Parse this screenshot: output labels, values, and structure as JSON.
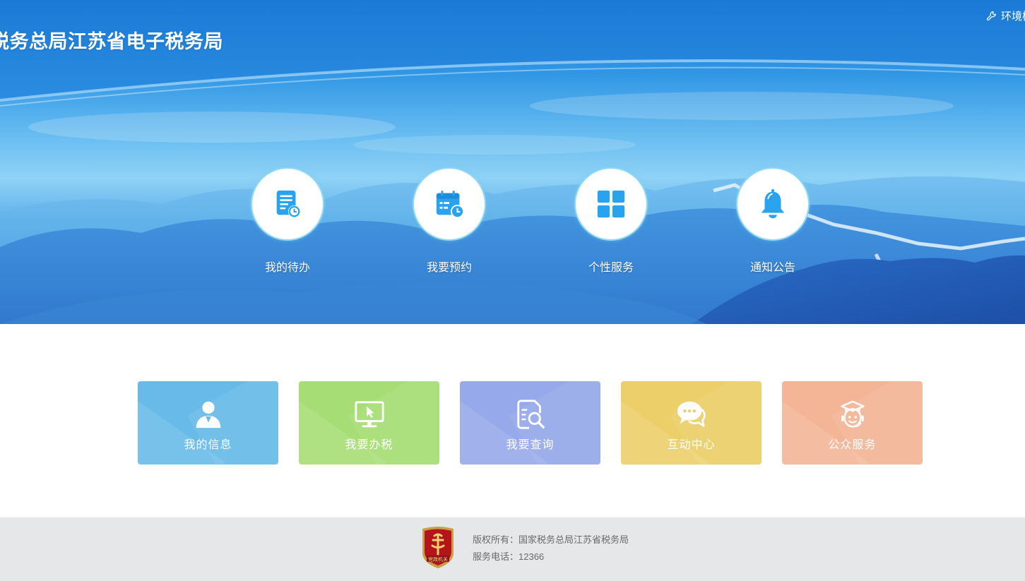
{
  "header": {
    "site_title": "税务总局江苏省电子税务局",
    "env_link": "环境检测"
  },
  "quick_actions": [
    {
      "label": "我的待办",
      "icon": "todo-document-clock-icon"
    },
    {
      "label": "我要预约",
      "icon": "calendar-clock-icon"
    },
    {
      "label": "个性服务",
      "icon": "grid-icon"
    },
    {
      "label": "通知公告",
      "icon": "bell-icon"
    }
  ],
  "services": [
    {
      "label": "我的信息",
      "icon": "user-icon",
      "color": "#68bbe8"
    },
    {
      "label": "我要办税",
      "icon": "monitor-cursor-icon",
      "color": "#a6dd74"
    },
    {
      "label": "我要查询",
      "icon": "document-search-icon",
      "color": "#96a9ea"
    },
    {
      "label": "互动中心",
      "icon": "chat-bubble-icon",
      "color": "#eccf69"
    },
    {
      "label": "公众服务",
      "icon": "service-agent-icon",
      "color": "#f3b596"
    }
  ],
  "footer": {
    "badge_text": "党政机关",
    "copyright": "版权所有：国家税务总局江苏省税务局",
    "phone": "服务电话：12366"
  },
  "colors": {
    "header_blue": "#1e7fd8",
    "quick_icon_blue": "#2aa3ee",
    "footer_bg": "#e6e7e9"
  }
}
